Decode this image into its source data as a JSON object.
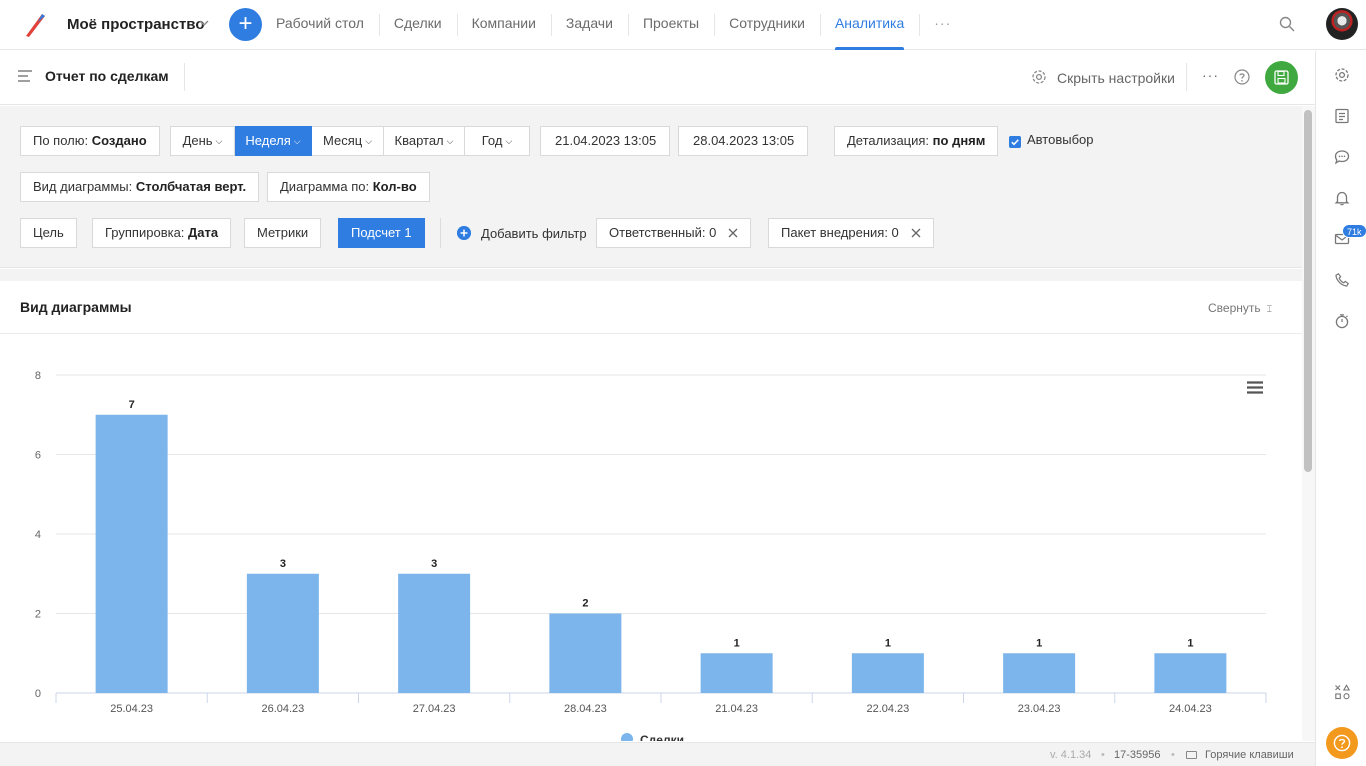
{
  "nav": {
    "workspace": "Моё пространство",
    "items": [
      {
        "label": "Рабочий стол"
      },
      {
        "label": "Сделки"
      },
      {
        "label": "Компании"
      },
      {
        "label": "Задачи"
      },
      {
        "label": "Проекты"
      },
      {
        "label": "Сотрудники"
      },
      {
        "label": "Аналитика",
        "active": true
      }
    ],
    "more": "···",
    "add": "+"
  },
  "subheader": {
    "title": "Отчет по сделкам",
    "hide_settings": "Скрыть настройки",
    "more": "···"
  },
  "filters": {
    "by_field_label": "По полю:",
    "by_field_value": "Создано",
    "periods": [
      "День",
      "Неделя",
      "Месяц",
      "Квартал",
      "Год"
    ],
    "active_period": "Неделя",
    "date_from": "21.04.2023 13:05",
    "date_to": "28.04.2023 13:05",
    "detail_label": "Детализация:",
    "detail_value": "по дням",
    "autoselect": "Автовыбор",
    "chart_type_label": "Вид диаграммы:",
    "chart_type_value": "Столбчатая верт.",
    "chart_by_label": "Диаграмма по:",
    "chart_by_value": "Кол-во",
    "goal": "Цель",
    "grouping_label": "Группировка:",
    "grouping_value": "Дата",
    "metrics": "Метрики",
    "count": "Подсчет 1",
    "add_filter": "Добавить фильтр",
    "responsible": "Ответственный: 0",
    "package": "Пакет внедрения: 0"
  },
  "panel": {
    "title": "Вид диаграммы",
    "collapse": "Свернуть"
  },
  "chart_data": {
    "type": "bar",
    "categories": [
      "25.04.23",
      "26.04.23",
      "27.04.23",
      "28.04.23",
      "21.04.23",
      "22.04.23",
      "23.04.23",
      "24.04.23"
    ],
    "series": [
      {
        "name": "Сделки",
        "values": [
          7,
          3,
          3,
          2,
          1,
          1,
          1,
          1
        ],
        "color": "#7cb5ec"
      }
    ],
    "y_ticks": [
      0,
      2,
      4,
      6,
      8
    ],
    "ylim": [
      0,
      8
    ],
    "grid": true,
    "legend": "bottom-center",
    "data_labels": true
  },
  "rail": {
    "badge": "71k"
  },
  "footer": {
    "version": "v. 4.1.34",
    "separator": "•",
    "build": "17-35956",
    "hotkeys": "Горячие клавиши"
  }
}
